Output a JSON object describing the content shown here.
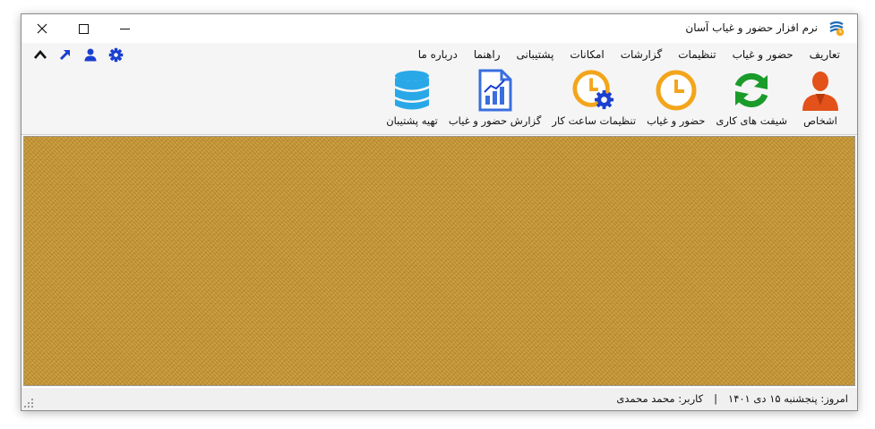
{
  "window": {
    "title": "نرم افزار حضور و غیاب آسان"
  },
  "menu": {
    "items": [
      "تعاریف",
      "حضور و غیاب",
      "تنظیمات",
      "گزارشات",
      "امکانات",
      "پشتیبانی",
      "راهنما",
      "درباره ما"
    ]
  },
  "quick_icons": [
    "gear-icon",
    "user-icon",
    "arrow-up-right-icon",
    "chevron-up-icon"
  ],
  "toolbar": {
    "items": [
      {
        "label": "اشخاص",
        "icon": "person-icon"
      },
      {
        "label": "شیفت های کاری",
        "icon": "refresh-icon"
      },
      {
        "label": "حضور و غیاب",
        "icon": "clock-icon"
      },
      {
        "label": "تنظیمات ساعت کار",
        "icon": "clock-gear-icon"
      },
      {
        "label": "گزارش حضور و غیاب",
        "icon": "report-icon"
      },
      {
        "label": "تهیه پشتیبان",
        "icon": "database-icon"
      }
    ]
  },
  "status": {
    "date": "امروز: پنجشنبه ۱۵ دی ۱۴۰۱",
    "separator": "|",
    "user": "کاربر: محمد محمدی"
  },
  "colors": {
    "accent_blue": "#1a3fd0",
    "content_background": "#c6952f",
    "clock_orange": "#f3a51b",
    "refresh_green": "#1a9b2a",
    "person_orange": "#e2521a",
    "database_blue": "#29a8e8"
  }
}
